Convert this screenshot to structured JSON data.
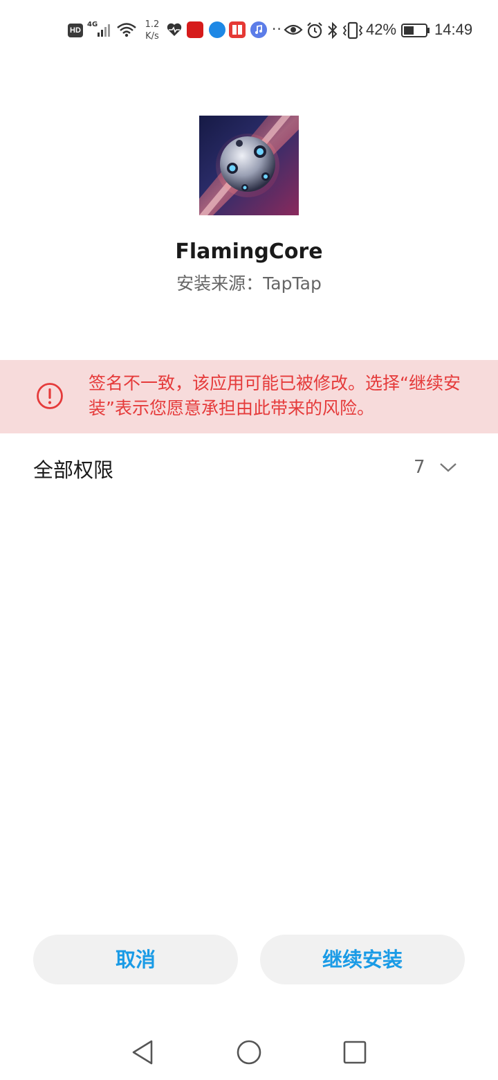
{
  "status_bar": {
    "hd": "HD",
    "network": "4G",
    "speed": "1.2\nK/s",
    "battery": "42%",
    "time": "14:49",
    "icons": [
      "hd-icon",
      "signal-icon",
      "wifi-icon",
      "heart-rate-icon",
      "app-notification-icons",
      "more-dots",
      "eye-icon",
      "alarm-icon",
      "bluetooth-icon",
      "vibrate-icon",
      "battery-icon"
    ]
  },
  "app": {
    "name": "FlamingCore",
    "source": "安装来源：TapTap",
    "icon": "flamingcore-app-icon"
  },
  "warning": {
    "icon": "alert-circle-icon",
    "color": "#e53a3a",
    "text": "签名不一致，该应用可能已被修改。选择“继续安装”表示您愿意承担由此带来的风险。"
  },
  "permissions": {
    "label": "全部权限",
    "count": "7",
    "icon": "chevron-down-icon"
  },
  "buttons": {
    "cancel": "取消",
    "continue": "继续安装",
    "accent": "#1a9be6"
  },
  "nav": {
    "back": "back-triangle-icon",
    "home": "home-circle-icon",
    "recent": "recents-square-icon"
  }
}
